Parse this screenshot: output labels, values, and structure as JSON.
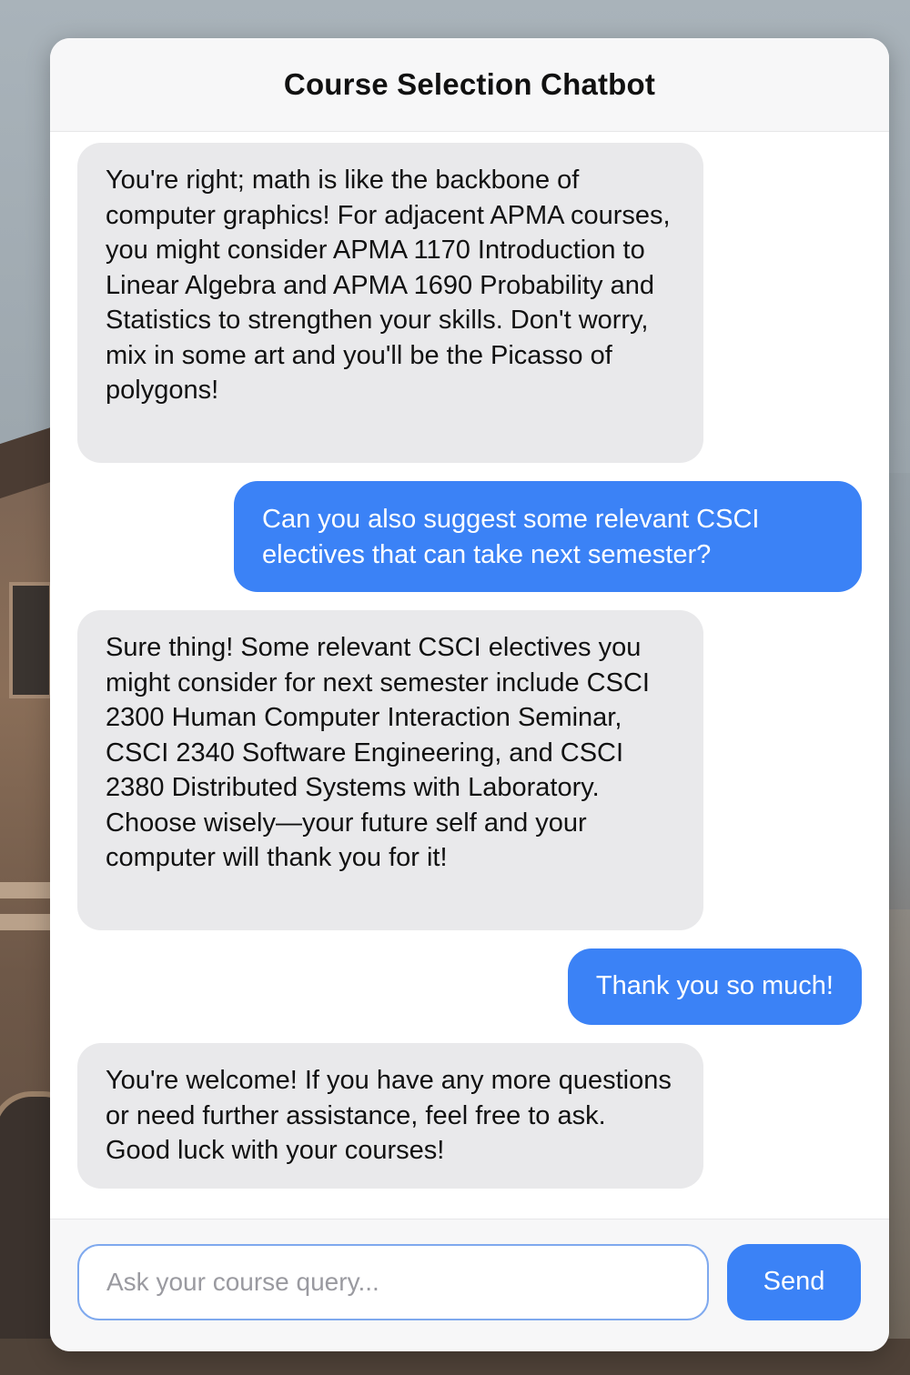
{
  "header": {
    "title": "Course Selection Chatbot"
  },
  "messages": [
    {
      "role": "bot",
      "text": "You're right; math is like the backbone of computer graphics! For adjacent APMA courses, you might consider APMA 1170 Introduction to Linear Algebra and APMA 1690 Probability and Statistics to strengthen your skills. Don't worry, mix in some art and you'll be the Picasso of polygons!"
    },
    {
      "role": "user",
      "text": "Can you also suggest some relevant CSCI electives that can take next semester?"
    },
    {
      "role": "bot",
      "text": "Sure thing! Some relevant CSCI electives you might consider for next semester include CSCI 2300 Human Computer Interaction Seminar, CSCI 2340 Software Engineering, and CSCI 2380 Distributed Systems with Laboratory. Choose wisely—your future self and your computer will thank you for it!"
    },
    {
      "role": "user",
      "text": "Thank you so much!"
    },
    {
      "role": "bot",
      "text": "You're welcome! If you have any more questions or need further assistance, feel free to ask. Good luck with your courses!"
    }
  ],
  "composer": {
    "placeholder": "Ask your course query...",
    "value": "",
    "send_label": "Send"
  },
  "colors": {
    "accent": "#3b82f6",
    "bot_bubble": "#e9e9eb",
    "panel": "#ffffff",
    "header_bg": "#f7f7f8"
  }
}
